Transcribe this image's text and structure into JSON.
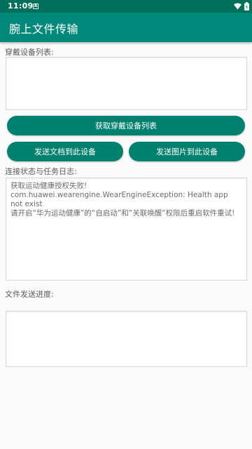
{
  "status_bar": {
    "time": "11:09",
    "notification_icon": "a-letter-icon",
    "wifi_icon": "wifi-icon",
    "battery_icon": "battery-icon"
  },
  "app_bar": {
    "title": "腕上文件传输"
  },
  "devices": {
    "label": "穿戴设备列表:",
    "content": ""
  },
  "buttons": {
    "get_devices": "获取穿戴设备列表",
    "send_document": "发送文档到此设备",
    "send_image": "发送图片到此设备"
  },
  "log": {
    "label": "连接状态与任务日志:",
    "content": "获取运动健康授权失败!\ncom.huawei.wearengine.WearEngineException: Health app not exist\n请开启“华为运动健康”的“自启动”和“关联唤醒”权限后重启软件重试!"
  },
  "progress": {
    "label": "文件发送进度:",
    "content": ""
  },
  "colors": {
    "status_bar": "#00705c",
    "app_bar": "#00897b",
    "button": "#00806f"
  }
}
